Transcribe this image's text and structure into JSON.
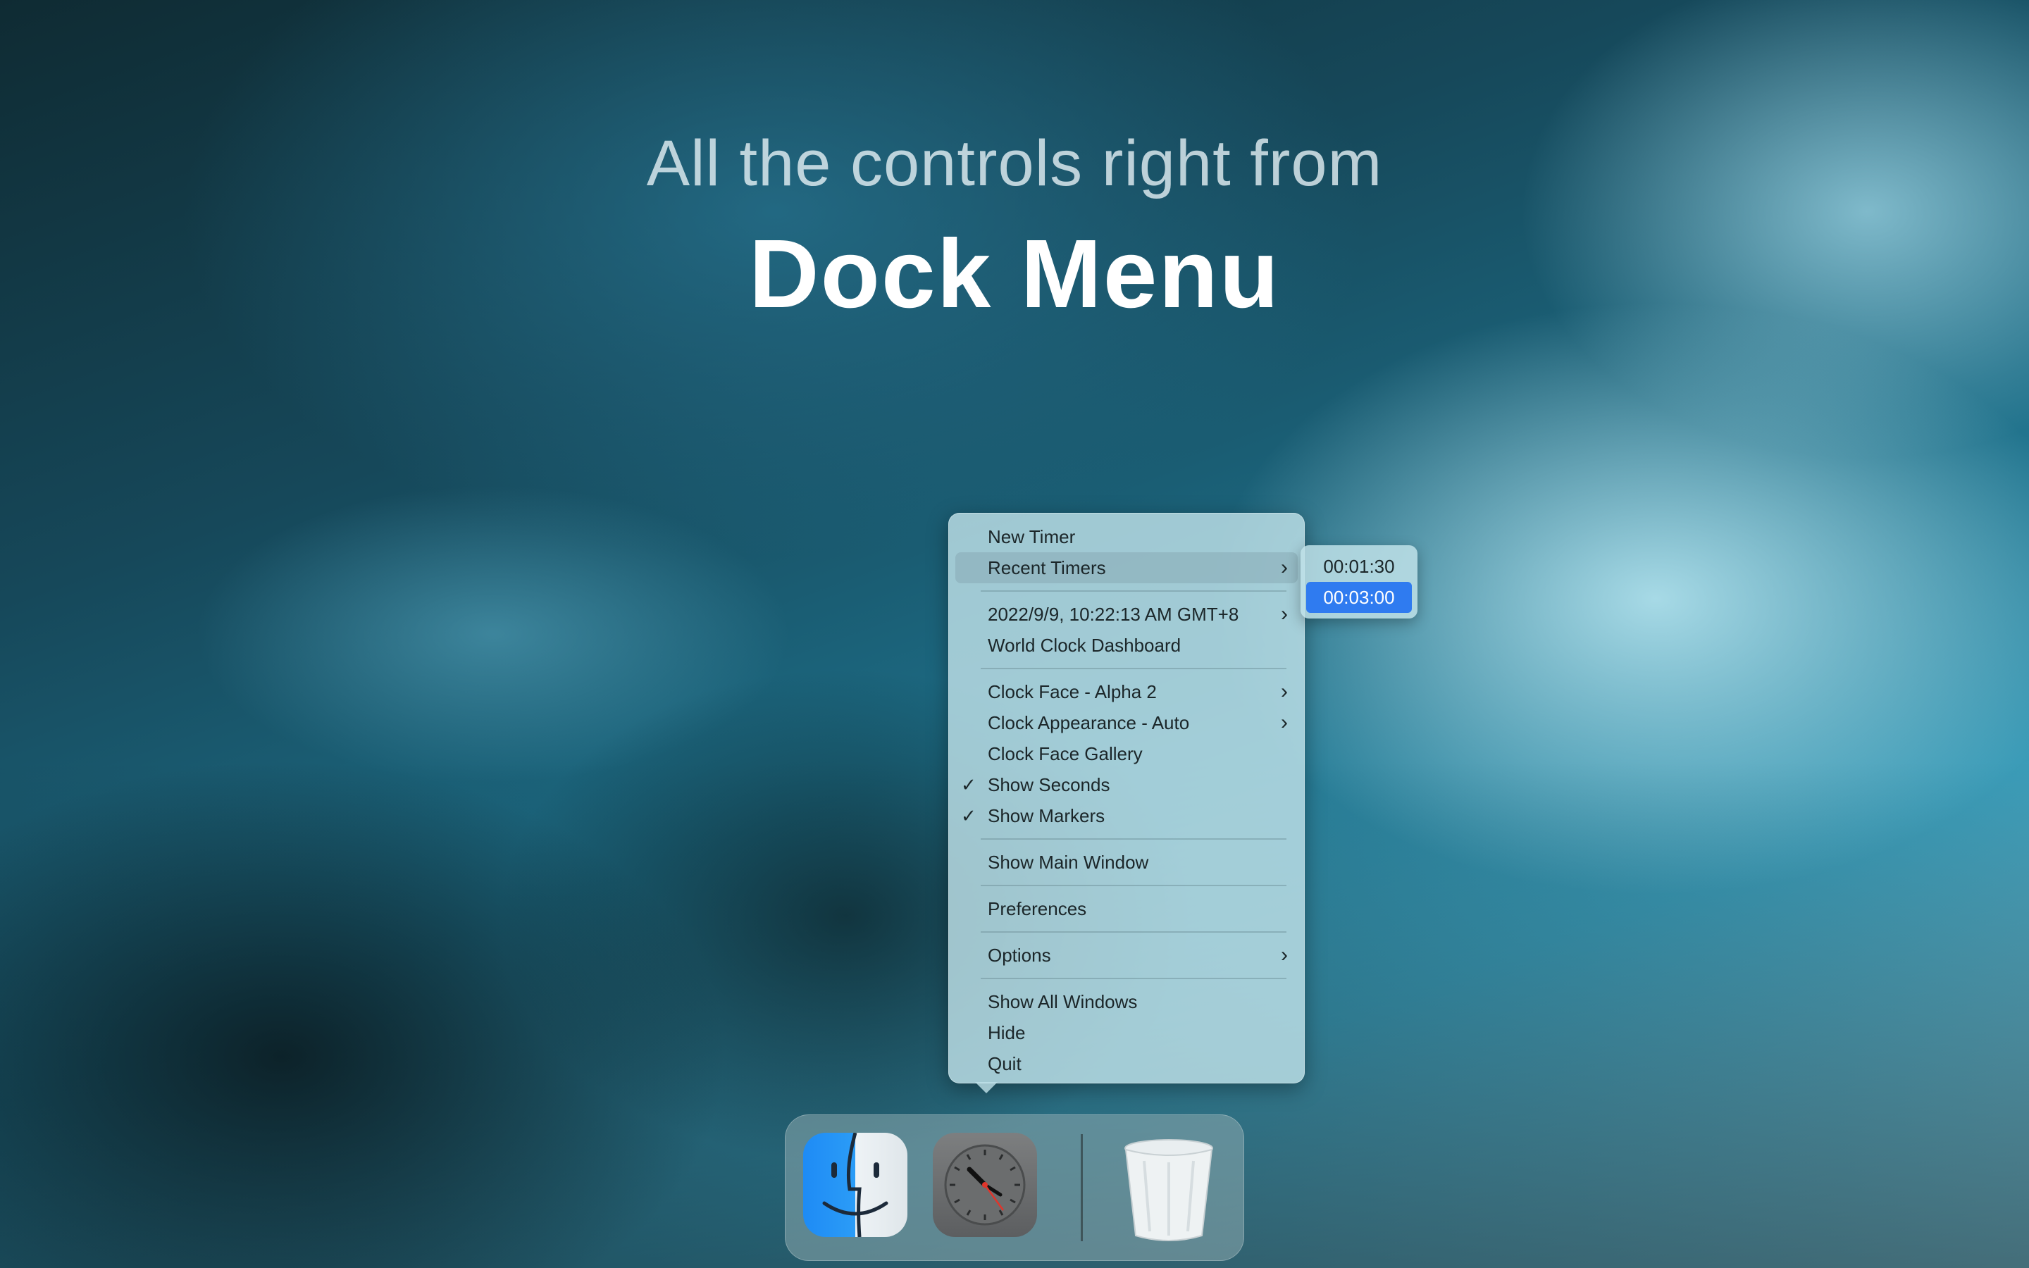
{
  "promo": {
    "headline": "All the controls right from",
    "title": "Dock Menu"
  },
  "dock_menu": {
    "items": [
      {
        "label": "New Timer"
      },
      {
        "label": "Recent Timers",
        "submenu": true,
        "highlighted": true
      },
      {
        "label": "2022/9/9, 10:22:13 AM GMT+8",
        "submenu": true
      },
      {
        "label": "World Clock Dashboard"
      },
      {
        "label": "Clock Face - Alpha 2",
        "submenu": true
      },
      {
        "label": "Clock Appearance - Auto",
        "submenu": true
      },
      {
        "label": "Clock Face Gallery"
      },
      {
        "label": "Show Seconds",
        "checked": true
      },
      {
        "label": "Show Markers",
        "checked": true
      },
      {
        "label": "Show Main Window"
      },
      {
        "label": "Preferences"
      },
      {
        "label": "Options",
        "submenu": true
      },
      {
        "label": "Show All Windows"
      },
      {
        "label": "Hide"
      },
      {
        "label": "Quit"
      }
    ],
    "chevron": "›",
    "checkmark": "✓"
  },
  "recent_timers_submenu": {
    "items": [
      {
        "label": "00:01:30",
        "selected": false
      },
      {
        "label": "00:03:00",
        "selected": true
      }
    ],
    "selection_color": "#2f7bf0"
  },
  "dock": {
    "apps": [
      {
        "icon": "finder-icon"
      },
      {
        "icon": "clock-app-icon"
      },
      {
        "icon": "trash-icon"
      }
    ]
  }
}
